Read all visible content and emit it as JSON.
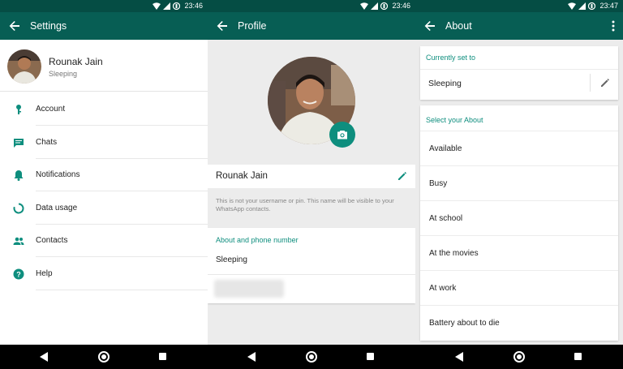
{
  "status_bar": [
    {
      "time": "23:46"
    },
    {
      "time": "23:46"
    },
    {
      "time": "23:47"
    }
  ],
  "settings": {
    "title": "Settings",
    "profile": {
      "name": "Rounak Jain",
      "status": "Sleeping"
    },
    "items": [
      {
        "label": "Account",
        "icon": "key-icon"
      },
      {
        "label": "Chats",
        "icon": "chat-icon"
      },
      {
        "label": "Notifications",
        "icon": "bell-icon"
      },
      {
        "label": "Data usage",
        "icon": "data-usage-icon"
      },
      {
        "label": "Contacts",
        "icon": "contacts-icon"
      },
      {
        "label": "Help",
        "icon": "help-icon"
      }
    ]
  },
  "profile_screen": {
    "title": "Profile",
    "name": "Rounak Jain",
    "hint": "This is not your username or pin. This name will be visible to your WhatsApp contacts.",
    "about_header": "About and phone number",
    "about_value": "Sleeping"
  },
  "about_screen": {
    "title": "About",
    "current_header": "Currently set to",
    "current_value": "Sleeping",
    "select_header": "Select your About",
    "options": [
      "Available",
      "Busy",
      "At school",
      "At the movies",
      "At work",
      "Battery about to die"
    ]
  },
  "colors": {
    "primary": "#075e54",
    "status_bar": "#054d44",
    "accent": "#0e8e7e"
  }
}
